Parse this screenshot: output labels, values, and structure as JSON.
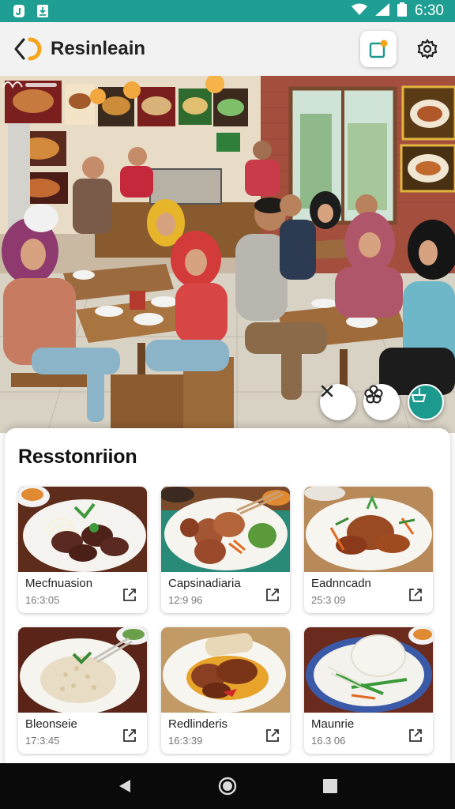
{
  "status_bar": {
    "time": "6:30",
    "icons": [
      "notification-j-icon",
      "download-icon",
      "wifi-icon",
      "signal-icon",
      "battery-icon"
    ],
    "background": "#1f9f93"
  },
  "app_bar": {
    "title": "Resinleain",
    "icons": [
      "back-arrow-icon",
      "note-edit-icon",
      "gear-icon"
    ]
  },
  "hero": {
    "description_icons": [
      "close-icon",
      "flower-icon",
      "basket-icon"
    ],
    "accent": "#1d9a8e"
  },
  "sheet": {
    "title": "Resstonriion",
    "cards": [
      {
        "name": "Mecfnuasion",
        "time": "16:3:05",
        "icon": "external-share-icon"
      },
      {
        "name": "Capsinadiaria",
        "time": "12:9 96",
        "icon": "external-share-icon"
      },
      {
        "name": "Eadnncadn",
        "time": "25:3 09",
        "icon": "external-share-icon"
      },
      {
        "name": "Bleonseie",
        "time": "17:3:45",
        "icon": "external-share-icon"
      },
      {
        "name": "Redlinderis",
        "time": "16:3:39",
        "icon": "external-share-icon"
      },
      {
        "name": "Maunrie",
        "time": "16.3 06",
        "icon": "external-share-icon"
      }
    ]
  },
  "nav_bar": {
    "icons": [
      "back-triangle-icon",
      "home-circle-icon",
      "recents-square-icon"
    ]
  }
}
